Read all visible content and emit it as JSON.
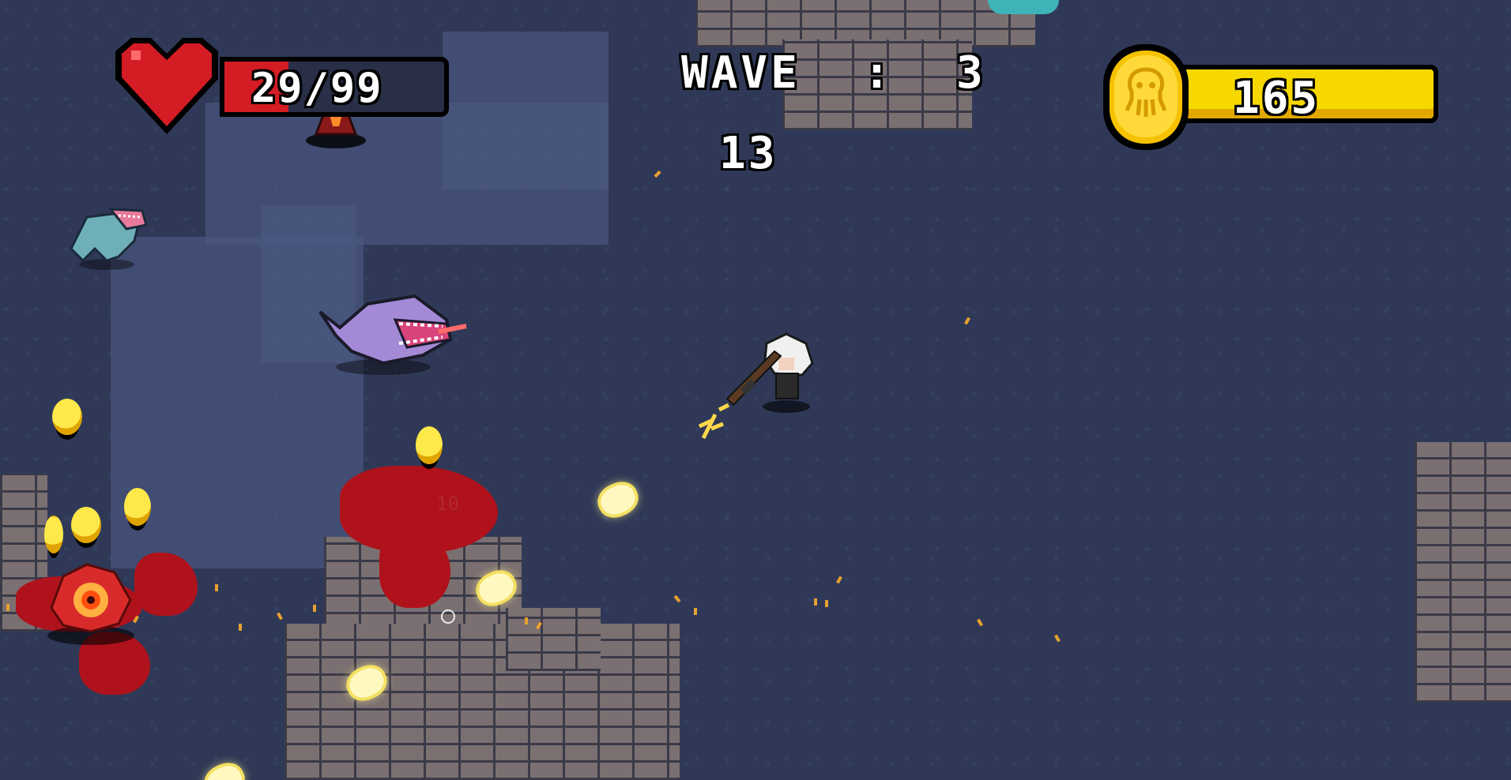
{
  "hud": {
    "health": {
      "current": 29,
      "max": 99,
      "label": "29/99",
      "fill_fraction": 0.29,
      "icon": "heart-icon",
      "color": "#d41c24"
    },
    "wave": {
      "label": "WAVE",
      "separator": ":",
      "number": "3"
    },
    "timer": "13",
    "coins": {
      "value": "165",
      "icon": "skull-coin-icon",
      "color": "#f6d800"
    }
  },
  "world": {
    "damage_popup": "10",
    "enemies": [
      "ghoul-enemy",
      "purple-worm-enemy",
      "red-eye-plant-enemy",
      "fire-brazier-enemy"
    ],
    "player": "white-haired-gunner",
    "colors": {
      "floor": "#2f3957",
      "patch": "#4b5781",
      "brick": "#7b7071",
      "blood": "#b0121c",
      "coin": "#ffd93a"
    }
  }
}
